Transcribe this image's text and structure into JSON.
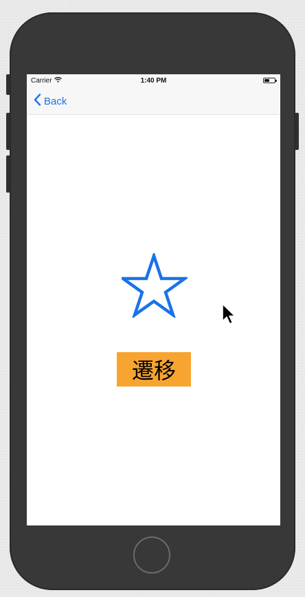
{
  "status_bar": {
    "carrier": "Carrier",
    "time": "1:40 PM",
    "battery_level": 0.5,
    "wifi_icon": "wifi-icon",
    "battery_icon": "battery-icon"
  },
  "nav": {
    "back_label": "Back",
    "back_icon": "chevron-left-icon"
  },
  "content": {
    "star_icon": "star-outline-icon",
    "star_color": "#1a73e8",
    "transit_button_label": "遷移",
    "transit_button_color": "#f7a530"
  }
}
